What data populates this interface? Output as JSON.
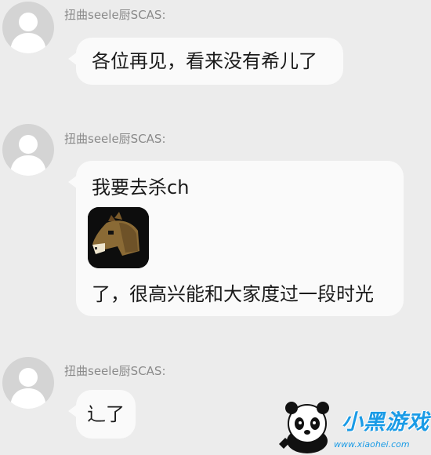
{
  "messages": [
    {
      "sender": "扭曲seele厨SCAS:",
      "lines": [
        "各位再见，看来没有希儿了"
      ]
    },
    {
      "sender": "扭曲seele厨SCAS:",
      "lines": [
        "我要去杀ch",
        "了，很高兴能和大家度过一段时光"
      ],
      "sticker": "brown-horse-sticker"
    },
    {
      "sender": "扭曲seele厨SCAS:",
      "lines": [
        "辶了"
      ]
    }
  ],
  "watermark": {
    "brand": "小黑游戏",
    "url": "www.xiaohei.com",
    "icon": "panda-mascot-icon"
  },
  "colors": {
    "background": "#ececec",
    "bubble": "#fafafa",
    "sender_text": "#8a8a8a",
    "avatar": "#d4d4d4",
    "brand": "#1a9be6"
  }
}
